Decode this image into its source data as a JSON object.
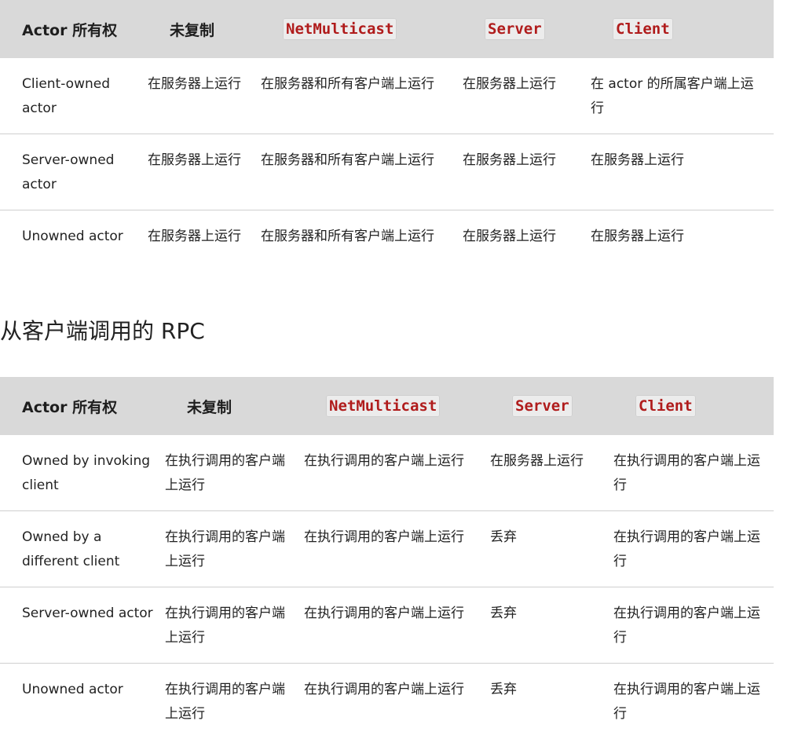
{
  "server_table": {
    "headers": [
      "Actor 所有权",
      "未复制",
      "NetMulticast",
      "Server",
      "Client"
    ],
    "rows": [
      {
        "owner": "Client-owned actor",
        "cells": [
          "在服务器上运行",
          "在服务器和所有客户端上运行",
          "在服务器上运行",
          "在 actor 的所属客户端上运行"
        ]
      },
      {
        "owner": "Server-owned actor",
        "cells": [
          "在服务器上运行",
          "在服务器和所有客户端上运行",
          "在服务器上运行",
          "在服务器上运行"
        ]
      },
      {
        "owner": "Unowned actor",
        "cells": [
          "在服务器上运行",
          "在服务器和所有客户端上运行",
          "在服务器上运行",
          "在服务器上运行"
        ]
      }
    ]
  },
  "section_heading": "从客户端调用的 RPC",
  "client_table": {
    "headers": [
      "Actor 所有权",
      "未复制",
      "NetMulticast",
      "Server",
      "Client"
    ],
    "rows": [
      {
        "owner": "Owned by invoking client",
        "cells": [
          "在执行调用的客户端上运行",
          "在执行调用的客户端上运行",
          "在服务器上运行",
          "在执行调用的客户端上运行"
        ]
      },
      {
        "owner": "Owned by a different client",
        "cells": [
          "在执行调用的客户端上运行",
          "在执行调用的客户端上运行",
          "丢弃",
          "在执行调用的客户端上运行"
        ]
      },
      {
        "owner": "Server-owned actor",
        "cells": [
          "在执行调用的客户端上运行",
          "在执行调用的客户端上运行",
          "丢弃",
          "在执行调用的客户端上运行"
        ]
      },
      {
        "owner": "Unowned actor",
        "cells": [
          "在执行调用的客户端上运行",
          "在执行调用的客户端上运行",
          "丢弃",
          "在执行调用的客户端上运行"
        ]
      }
    ]
  },
  "colors": {
    "header_bg": "#d9d9d9",
    "code_text": "#b01c1c",
    "code_bg": "#ececec",
    "divider": "#cfcfcf"
  }
}
